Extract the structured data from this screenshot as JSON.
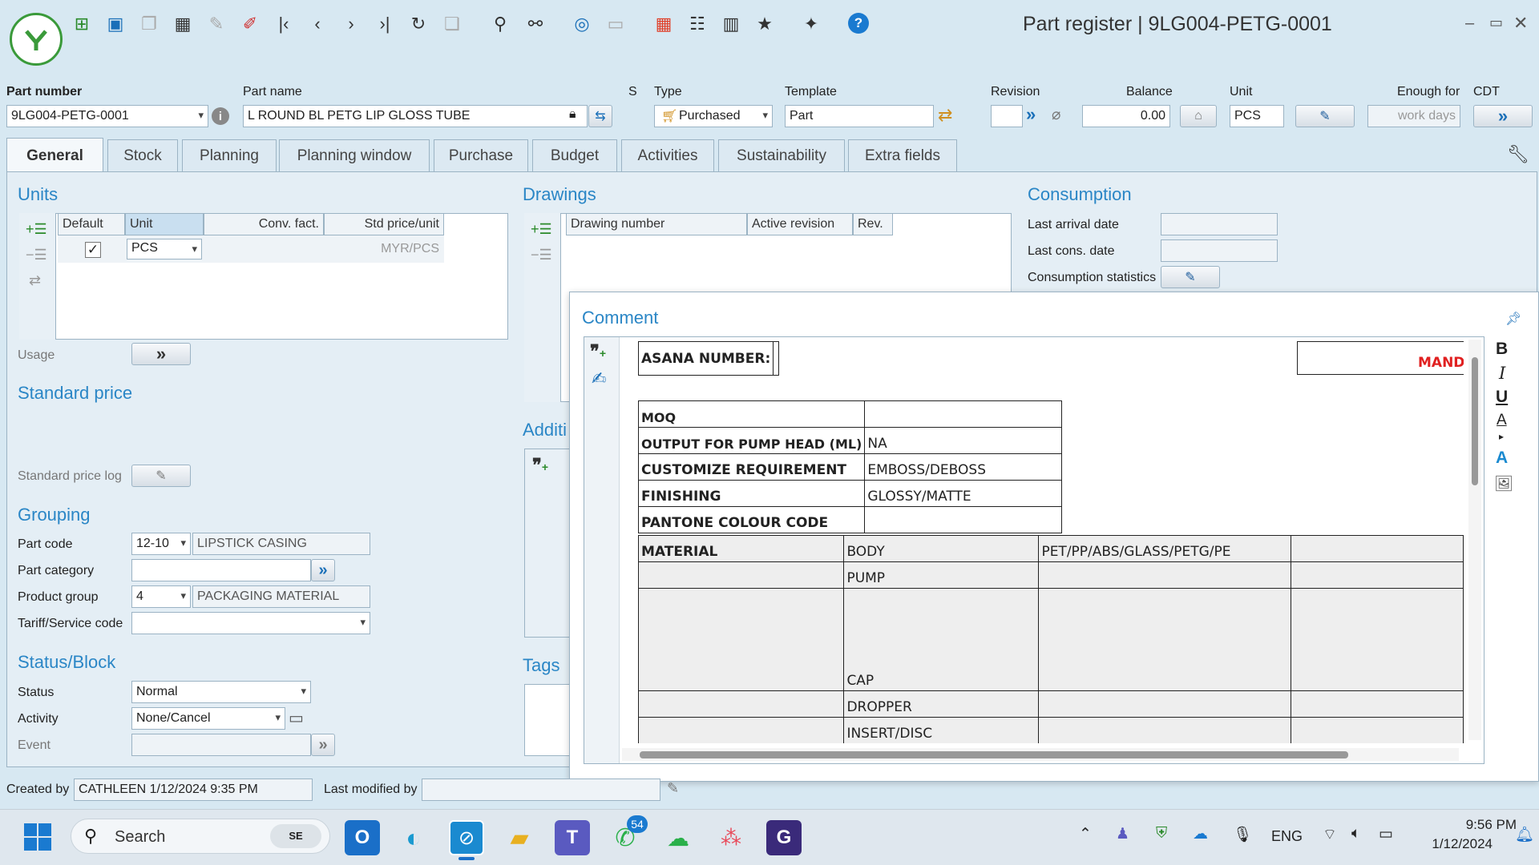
{
  "window": {
    "title": "Part register | 9LG004-PETG-0001",
    "controls": [
      "–",
      "▭",
      "✕"
    ]
  },
  "toolbar": {
    "icons": [
      "new-icon",
      "save-icon",
      "copy-icon",
      "calendar-icon",
      "attach-icon",
      "eraser-icon",
      "first-record-icon",
      "prev-record-icon",
      "next-record-icon",
      "last-record-icon",
      "refresh-icon",
      "paste-icon",
      "search-icon",
      "link-icon",
      "fingerprint-icon",
      "window-icon",
      "apps-grid-icon",
      "settings-list-icon",
      "bookmark-icon",
      "star-icon",
      "plug-icon",
      "help-icon"
    ]
  },
  "header": {
    "part_number_label": "Part number",
    "part_number": "9LG004-PETG-0001",
    "part_name_label": "Part name",
    "part_name": "L ROUND BL PETG LIP GLOSS TUBE",
    "s_label": "S",
    "type_label": "Type",
    "type_value": "Purchased",
    "template_label": "Template",
    "template_value": "Part",
    "revision_label": "Revision",
    "revision_value": "",
    "balance_label": "Balance",
    "balance_value": "0.00",
    "unit_label": "Unit",
    "unit_value": "PCS",
    "enough_label": "Enough for",
    "enough_value": "work days",
    "cdt_label": "CDT"
  },
  "tabs": [
    {
      "label": "General",
      "active": true
    },
    {
      "label": "Stock"
    },
    {
      "label": "Planning"
    },
    {
      "label": "Planning window"
    },
    {
      "label": "Purchase"
    },
    {
      "label": "Budget"
    },
    {
      "label": "Activities"
    },
    {
      "label": "Sustainability"
    },
    {
      "label": "Extra fields"
    }
  ],
  "units": {
    "title": "Units",
    "columns": [
      "Default",
      "Unit",
      "Conv. fact.",
      "Std price/unit"
    ],
    "row": {
      "unit": "PCS",
      "conv": "",
      "std_price": "MYR/PCS"
    },
    "usage_label": "Usage"
  },
  "standard_price": {
    "title": "Standard price",
    "log_label": "Standard price log"
  },
  "grouping": {
    "title": "Grouping",
    "part_code_label": "Part code",
    "part_code": "12-10",
    "part_code_desc": "LIPSTICK CASING",
    "part_category_label": "Part category",
    "product_group_label": "Product group",
    "product_group": "4",
    "product_group_desc": "PACKAGING MATERIAL",
    "tariff_label": "Tariff/Service code"
  },
  "status_block": {
    "title": "Status/Block",
    "status_label": "Status",
    "status_value": "Normal",
    "activity_label": "Activity",
    "activity_value": "None/Cancel",
    "event_label": "Event"
  },
  "drawings": {
    "title": "Drawings",
    "columns": [
      "Drawing number",
      "Active revision",
      "Rev."
    ],
    "additional_title": "Additi",
    "tags_title": "Tags"
  },
  "consumption": {
    "title": "Consumption",
    "last_arrival_label": "Last arrival date",
    "last_cons_label": "Last cons. date",
    "stats_label": "Consumption statistics"
  },
  "comment": {
    "title": "Comment",
    "format_buttons": [
      "B",
      "I",
      "U",
      "A",
      "A"
    ],
    "table": {
      "asana_label": "ASANA NUMBER:",
      "mand_label": "MAND",
      "moq_label": "MOQ",
      "output_label": "OUTPUT FOR PUMP HEAD (ML)",
      "output_value": "NA",
      "customize_label": "CUSTOMIZE REQUIREMENT",
      "customize_value": "EMBOSS/DEBOSS",
      "finishing_label": "FINISHING",
      "finishing_value": "GLOSSY/MATTE",
      "pantone_label": "PANTONE COLOUR CODE",
      "material_label": "MATERIAL",
      "body_label": "BODY",
      "body_value": "PET/PP/ABS/GLASS/PETG/PE",
      "pump_label": "PUMP",
      "cap_label": "CAP",
      "dropper_label": "DROPPER",
      "insert_label": "INSERT/DISC"
    }
  },
  "footer": {
    "created_by_label": "Created by",
    "created_by_value": "CATHLEEN 1/12/2024 9:35 PM",
    "modified_label": "Last modified by",
    "modified_value": ""
  },
  "taskbar": {
    "search_placeholder": "Search",
    "whatsapp_badge": "54",
    "lang": "ENG",
    "time": "9:56 PM",
    "date": "1/12/2024"
  },
  "colors": {
    "accent": "#2a86c6",
    "background": "#d7e8f2",
    "mand_red": "#e02020"
  }
}
